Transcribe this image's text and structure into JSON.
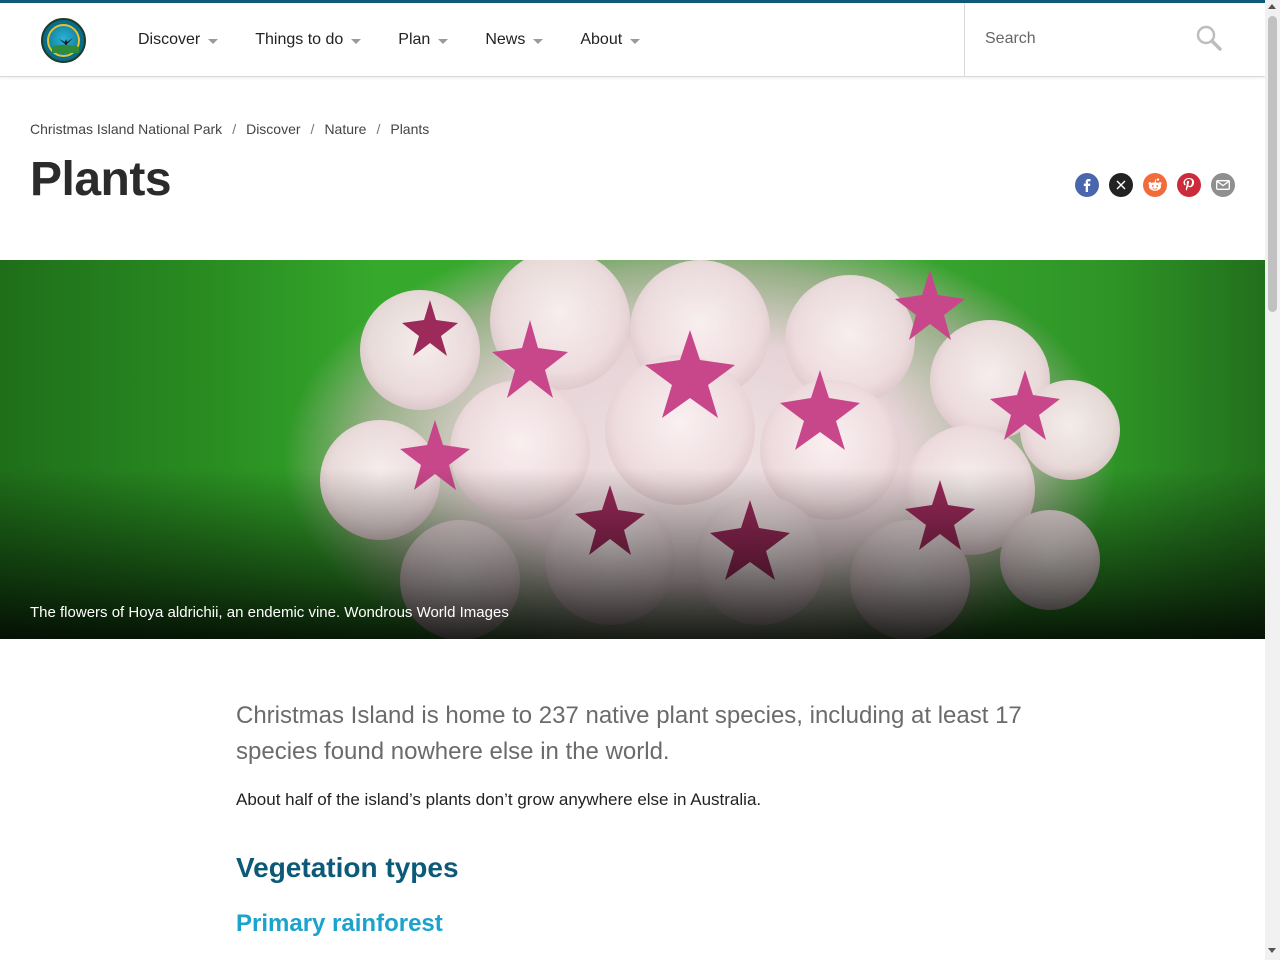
{
  "header": {
    "logo_text": "Christmas Island National Park",
    "nav": [
      {
        "label": "Discover"
      },
      {
        "label": "Things to do"
      },
      {
        "label": "Plan"
      },
      {
        "label": "News"
      },
      {
        "label": "About"
      }
    ],
    "search": {
      "placeholder": "Search",
      "value": ""
    }
  },
  "breadcrumb": [
    {
      "label": "Christmas Island National Park"
    },
    {
      "label": "Discover"
    },
    {
      "label": "Nature"
    },
    {
      "label": "Plants"
    }
  ],
  "page": {
    "title": "Plants"
  },
  "share": [
    "facebook-icon",
    "x-icon",
    "reddit-icon",
    "pinterest-icon",
    "email-icon"
  ],
  "hero": {
    "caption": "The flowers of Hoya aldrichii, an endemic vine. Wondrous World Images"
  },
  "article": {
    "lead": "Christmas Island is home to 237 native plant species, including at least 17 species found nowhere else in the world.",
    "body": "About half of the island’s plants don’t grow anywhere else in Australia.",
    "h2": "Vegetation types",
    "h3": "Primary rainforest"
  },
  "colors": {
    "accent": "#0d5a78",
    "subheading": "#1aa3cc",
    "facebook": "#4a67ad",
    "x": "#222222",
    "reddit": "#f26b3a",
    "pinterest": "#cb2b3a",
    "email": "#8f8f8f"
  }
}
